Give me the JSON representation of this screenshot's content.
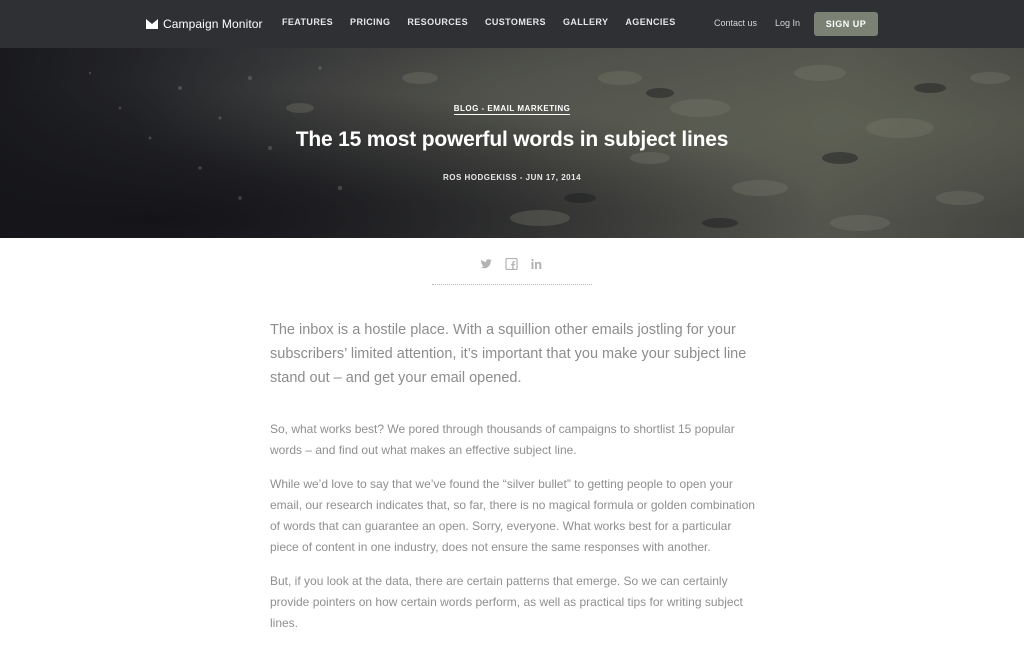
{
  "nav": {
    "brand": "Campaign Monitor",
    "links": [
      "FEATURES",
      "PRICING",
      "RESOURCES",
      "CUSTOMERS",
      "GALLERY",
      "AGENCIES"
    ],
    "contact": "Contact us",
    "login": "Log In",
    "signup": "SIGN UP"
  },
  "hero": {
    "category": "BLOG - EMAIL MARKETING",
    "title": "The 15 most powerful words in subject lines",
    "meta": "ROS HODGEKISS - JUN 17, 2014"
  },
  "share": {
    "icons": [
      "twitter-icon",
      "facebook-icon",
      "linkedin-icon"
    ]
  },
  "article": {
    "lede": "The inbox is a hostile place. With a squillion other emails jostling for your subscribers’ limited attention, it’s important that you make your subject line stand out – and get your email opened.",
    "paragraphs": [
      "So, what works best? We pored through thousands of campaigns to shortlist 15 popular words – and find out what makes an effective subject line.",
      "While we’d love to say that we’ve found the “silver bullet” to getting people to open your email, our research indicates that, so far, there is no magical formula or golden combination of words that can guarantee an open. Sorry, everyone. What works best for a particular piece of content in one industry, does not ensure the same responses with another.",
      "But, if you look at the data, there are certain patterns that emerge. So we can certainly provide pointers on how certain words perform, as well as practical tips for writing subject lines."
    ]
  },
  "colors": {
    "nav_bg": "#2f3034",
    "signup_bg": "#7b8273",
    "body_text": "#8f8f8f"
  }
}
